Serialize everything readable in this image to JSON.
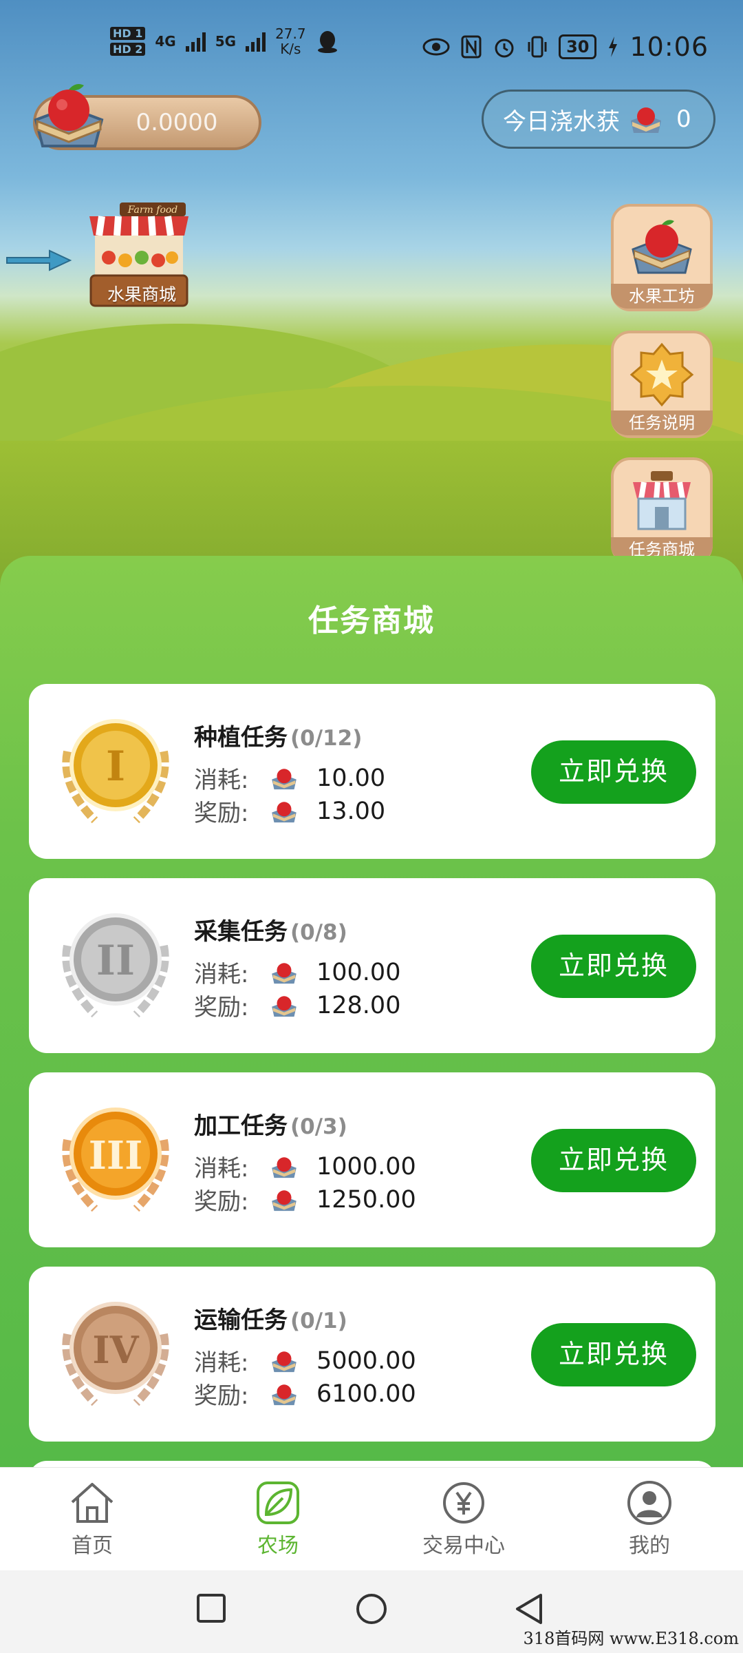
{
  "status_bar": {
    "hd1": "HD 1",
    "hd2": "HD 2",
    "net1": "4G",
    "net2": "5G",
    "speed_value": "27.7",
    "speed_unit": "K/s",
    "battery": "30",
    "time": "10:06"
  },
  "header": {
    "balance": "0.0000",
    "today_label": "今日浇水获",
    "today_count": "0"
  },
  "stall": {
    "label": "水果商城",
    "sign_text": "Farm food"
  },
  "side_buttons": [
    {
      "label": "水果工坊",
      "icon": "fruit-basket-icon"
    },
    {
      "label": "任务说明",
      "icon": "star-badge-icon"
    },
    {
      "label": "任务商城",
      "icon": "shop-icon"
    }
  ],
  "sheet": {
    "title": "任务商城",
    "cost_label": "消耗:",
    "reward_label": "奖励:",
    "button_label": "立即兑换",
    "tasks": [
      {
        "name": "种植任务",
        "progress": "(0/12)",
        "cost": "10.00",
        "reward": "13.00",
        "medal": "I",
        "medal_color": "#e3a81a"
      },
      {
        "name": "采集任务",
        "progress": "(0/8)",
        "cost": "100.00",
        "reward": "128.00",
        "medal": "II",
        "medal_color": "#a9a9a9"
      },
      {
        "name": "加工任务",
        "progress": "(0/3)",
        "cost": "1000.00",
        "reward": "1250.00",
        "medal": "III",
        "medal_color": "#e88a0c"
      },
      {
        "name": "运输任务",
        "progress": "(0/1)",
        "cost": "5000.00",
        "reward": "6100.00",
        "medal": "IV",
        "medal_color": "#b98660"
      }
    ]
  },
  "nav": {
    "items": [
      {
        "label": "首页",
        "icon": "home-icon"
      },
      {
        "label": "农场",
        "icon": "leaf-icon"
      },
      {
        "label": "交易中心",
        "icon": "yuan-icon"
      },
      {
        "label": "我的",
        "icon": "user-icon"
      }
    ],
    "active_index": 1,
    "active_color": "#5cb531"
  },
  "watermark": "318首码网 www.E318.com"
}
